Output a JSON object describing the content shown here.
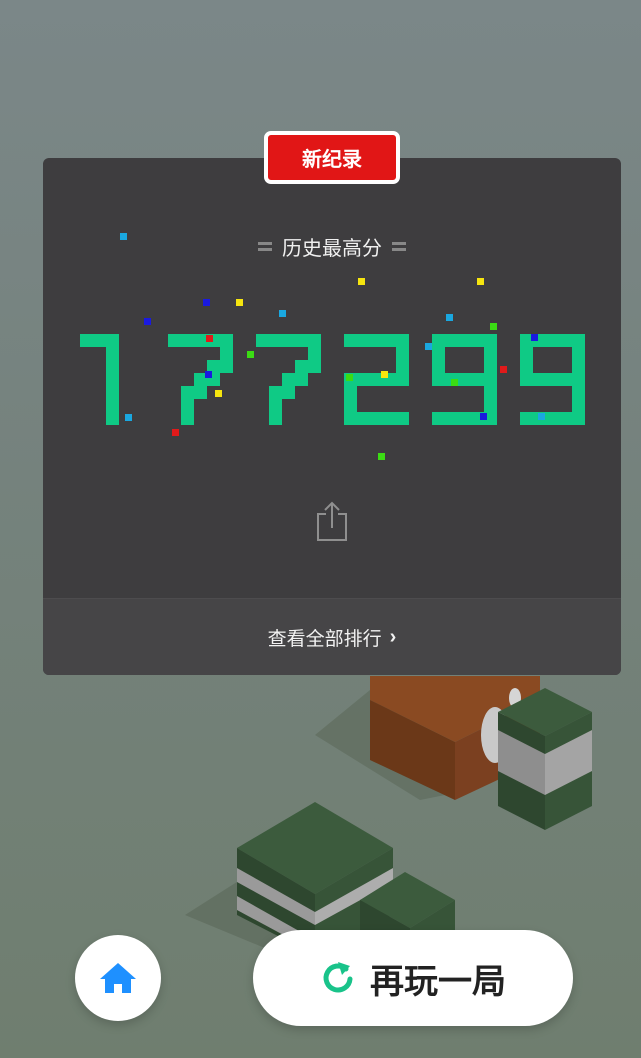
{
  "badge": {
    "label": "新纪录"
  },
  "best": {
    "label": "历史最高分",
    "score": "177299"
  },
  "footer": {
    "label": "查看全部排行",
    "chevron": "›"
  },
  "buttons": {
    "home_icon": "home-icon",
    "share_icon": "share-icon",
    "replay_icon": "replay-icon",
    "replay_label": "再玩一局"
  },
  "colors": {
    "card": "#3e3d3f",
    "score_digits": "#0fca85",
    "badge": "#e11616",
    "home_icon": "#1e90ff",
    "replay_icon": "#19c38a"
  }
}
